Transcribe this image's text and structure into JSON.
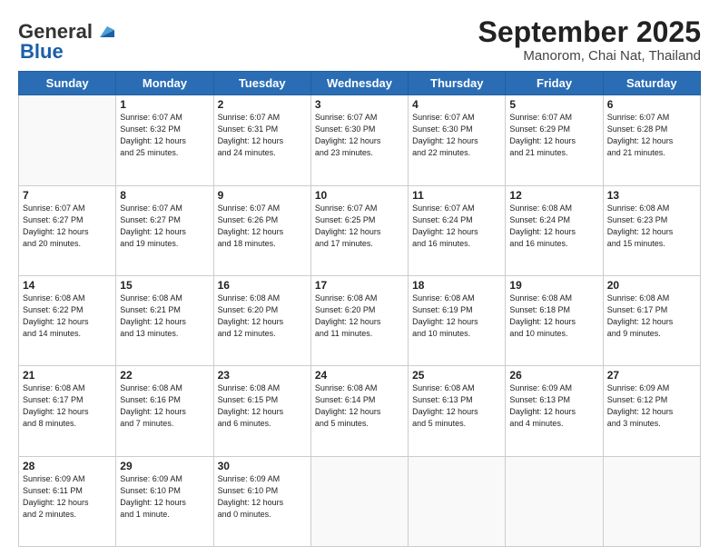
{
  "header": {
    "logo_general": "General",
    "logo_blue": "Blue",
    "month_title": "September 2025",
    "location": "Manorom, Chai Nat, Thailand"
  },
  "days_of_week": [
    "Sunday",
    "Monday",
    "Tuesday",
    "Wednesday",
    "Thursday",
    "Friday",
    "Saturday"
  ],
  "weeks": [
    [
      {
        "day": "",
        "info": ""
      },
      {
        "day": "1",
        "info": "Sunrise: 6:07 AM\nSunset: 6:32 PM\nDaylight: 12 hours\nand 25 minutes."
      },
      {
        "day": "2",
        "info": "Sunrise: 6:07 AM\nSunset: 6:31 PM\nDaylight: 12 hours\nand 24 minutes."
      },
      {
        "day": "3",
        "info": "Sunrise: 6:07 AM\nSunset: 6:30 PM\nDaylight: 12 hours\nand 23 minutes."
      },
      {
        "day": "4",
        "info": "Sunrise: 6:07 AM\nSunset: 6:30 PM\nDaylight: 12 hours\nand 22 minutes."
      },
      {
        "day": "5",
        "info": "Sunrise: 6:07 AM\nSunset: 6:29 PM\nDaylight: 12 hours\nand 21 minutes."
      },
      {
        "day": "6",
        "info": "Sunrise: 6:07 AM\nSunset: 6:28 PM\nDaylight: 12 hours\nand 21 minutes."
      }
    ],
    [
      {
        "day": "7",
        "info": "Sunrise: 6:07 AM\nSunset: 6:27 PM\nDaylight: 12 hours\nand 20 minutes."
      },
      {
        "day": "8",
        "info": "Sunrise: 6:07 AM\nSunset: 6:27 PM\nDaylight: 12 hours\nand 19 minutes."
      },
      {
        "day": "9",
        "info": "Sunrise: 6:07 AM\nSunset: 6:26 PM\nDaylight: 12 hours\nand 18 minutes."
      },
      {
        "day": "10",
        "info": "Sunrise: 6:07 AM\nSunset: 6:25 PM\nDaylight: 12 hours\nand 17 minutes."
      },
      {
        "day": "11",
        "info": "Sunrise: 6:07 AM\nSunset: 6:24 PM\nDaylight: 12 hours\nand 16 minutes."
      },
      {
        "day": "12",
        "info": "Sunrise: 6:08 AM\nSunset: 6:24 PM\nDaylight: 12 hours\nand 16 minutes."
      },
      {
        "day": "13",
        "info": "Sunrise: 6:08 AM\nSunset: 6:23 PM\nDaylight: 12 hours\nand 15 minutes."
      }
    ],
    [
      {
        "day": "14",
        "info": "Sunrise: 6:08 AM\nSunset: 6:22 PM\nDaylight: 12 hours\nand 14 minutes."
      },
      {
        "day": "15",
        "info": "Sunrise: 6:08 AM\nSunset: 6:21 PM\nDaylight: 12 hours\nand 13 minutes."
      },
      {
        "day": "16",
        "info": "Sunrise: 6:08 AM\nSunset: 6:20 PM\nDaylight: 12 hours\nand 12 minutes."
      },
      {
        "day": "17",
        "info": "Sunrise: 6:08 AM\nSunset: 6:20 PM\nDaylight: 12 hours\nand 11 minutes."
      },
      {
        "day": "18",
        "info": "Sunrise: 6:08 AM\nSunset: 6:19 PM\nDaylight: 12 hours\nand 10 minutes."
      },
      {
        "day": "19",
        "info": "Sunrise: 6:08 AM\nSunset: 6:18 PM\nDaylight: 12 hours\nand 10 minutes."
      },
      {
        "day": "20",
        "info": "Sunrise: 6:08 AM\nSunset: 6:17 PM\nDaylight: 12 hours\nand 9 minutes."
      }
    ],
    [
      {
        "day": "21",
        "info": "Sunrise: 6:08 AM\nSunset: 6:17 PM\nDaylight: 12 hours\nand 8 minutes."
      },
      {
        "day": "22",
        "info": "Sunrise: 6:08 AM\nSunset: 6:16 PM\nDaylight: 12 hours\nand 7 minutes."
      },
      {
        "day": "23",
        "info": "Sunrise: 6:08 AM\nSunset: 6:15 PM\nDaylight: 12 hours\nand 6 minutes."
      },
      {
        "day": "24",
        "info": "Sunrise: 6:08 AM\nSunset: 6:14 PM\nDaylight: 12 hours\nand 5 minutes."
      },
      {
        "day": "25",
        "info": "Sunrise: 6:08 AM\nSunset: 6:13 PM\nDaylight: 12 hours\nand 5 minutes."
      },
      {
        "day": "26",
        "info": "Sunrise: 6:09 AM\nSunset: 6:13 PM\nDaylight: 12 hours\nand 4 minutes."
      },
      {
        "day": "27",
        "info": "Sunrise: 6:09 AM\nSunset: 6:12 PM\nDaylight: 12 hours\nand 3 minutes."
      }
    ],
    [
      {
        "day": "28",
        "info": "Sunrise: 6:09 AM\nSunset: 6:11 PM\nDaylight: 12 hours\nand 2 minutes."
      },
      {
        "day": "29",
        "info": "Sunrise: 6:09 AM\nSunset: 6:10 PM\nDaylight: 12 hours\nand 1 minute."
      },
      {
        "day": "30",
        "info": "Sunrise: 6:09 AM\nSunset: 6:10 PM\nDaylight: 12 hours\nand 0 minutes."
      },
      {
        "day": "",
        "info": ""
      },
      {
        "day": "",
        "info": ""
      },
      {
        "day": "",
        "info": ""
      },
      {
        "day": "",
        "info": ""
      }
    ]
  ]
}
